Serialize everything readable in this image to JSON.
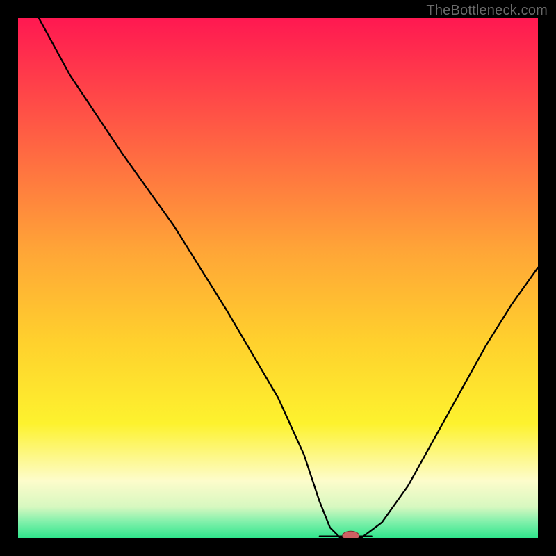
{
  "watermark": "TheBottleneck.com",
  "colors": {
    "frame": "#000000",
    "watermark": "#6a6a6a",
    "curve": "#000000",
    "marker_fill": "#cd5f63",
    "gradient_top": "#ff1851",
    "gradient_mid1": "#ff7d3d",
    "gradient_mid2": "#ffd02d",
    "gradient_mid3": "#fdf22e",
    "gradient_pale": "#fdfccb",
    "gradient_green": "#2fe58c"
  },
  "chart_data": {
    "type": "line",
    "title": "",
    "xlabel": "",
    "ylabel": "",
    "xlim": [
      0,
      100
    ],
    "ylim": [
      0,
      100
    ],
    "series": [
      {
        "name": "bottleneck-curve",
        "x": [
          4,
          10,
          20,
          30,
          40,
          50,
          55,
          58,
          60,
          62,
          66,
          70,
          75,
          80,
          85,
          90,
          95,
          100
        ],
        "y": [
          100,
          89,
          74,
          60,
          44,
          27,
          16,
          7,
          2,
          0,
          0,
          3,
          10,
          19,
          28,
          37,
          45,
          52
        ]
      }
    ],
    "marker": {
      "x": 64,
      "y": 0,
      "rx": 1.6,
      "ry": 0.9
    },
    "flat_segment": {
      "x0": 58,
      "x1": 68,
      "y": 0.3
    }
  }
}
